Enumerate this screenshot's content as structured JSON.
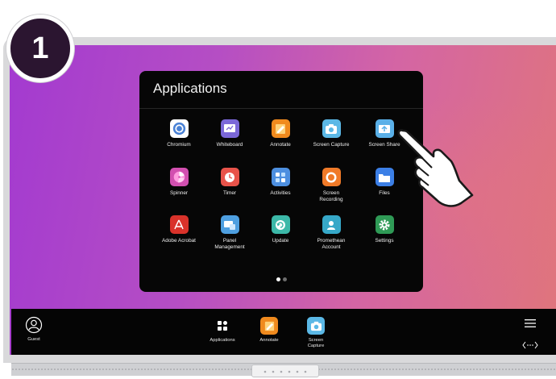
{
  "step": {
    "number": "1"
  },
  "apps_panel": {
    "title": "Applications",
    "apps": [
      {
        "label_lines": [
          "Chromium"
        ],
        "icon": "chromium-icon",
        "color": "#5b8fd6"
      },
      {
        "label_lines": [
          "Whiteboard"
        ],
        "icon": "whiteboard-icon",
        "color": "#7b68d8"
      },
      {
        "label_lines": [
          "Annotate"
        ],
        "icon": "annotate-icon",
        "color": "#f08a1e"
      },
      {
        "label_lines": [
          "Screen Capture"
        ],
        "icon": "screen-capture-icon",
        "color": "#5bb8e6"
      },
      {
        "label_lines": [
          "Screen Share"
        ],
        "icon": "screen-share-icon",
        "color": "#5ab0e8"
      },
      {
        "label_lines": [
          "Spinner"
        ],
        "icon": "spinner-icon",
        "color": "#d24fb0"
      },
      {
        "label_lines": [
          "Timer"
        ],
        "icon": "timer-icon",
        "color": "#e8534a"
      },
      {
        "label_lines": [
          "Activities"
        ],
        "icon": "activities-icon",
        "color": "#4d8fe0"
      },
      {
        "label_lines": [
          "Screen",
          "Recording"
        ],
        "icon": "screen-recording-icon",
        "color": "#f07a28"
      },
      {
        "label_lines": [
          "Files"
        ],
        "icon": "files-icon",
        "color": "#3c7fe6"
      },
      {
        "label_lines": [
          "Adobe Acrobat"
        ],
        "icon": "adobe-acrobat-icon",
        "color": "#d9322a"
      },
      {
        "label_lines": [
          "Panel",
          "Management"
        ],
        "icon": "panel-management-icon",
        "color": "#4e9fe0"
      },
      {
        "label_lines": [
          "Update"
        ],
        "icon": "update-icon",
        "color": "#3cb8a8"
      },
      {
        "label_lines": [
          "Promethean",
          "Account"
        ],
        "icon": "promethean-account-icon",
        "color": "#36a8c8"
      },
      {
        "label_lines": [
          "Settings"
        ],
        "icon": "settings-icon",
        "color": "#2f9a56"
      }
    ],
    "page_count": 2,
    "active_page": 1
  },
  "taskbar": {
    "user": {
      "label": "Guest",
      "icon": "user-icon"
    },
    "items": [
      {
        "label_lines": [
          "Applications"
        ],
        "icon": "applications-grid-icon"
      },
      {
        "label_lines": [
          "Annotate"
        ],
        "icon": "annotate-icon"
      },
      {
        "label_lines": [
          "Screen",
          "Capture"
        ],
        "icon": "screen-capture-icon"
      }
    ],
    "menu_icon": "hamburger-menu-icon",
    "expand_icon": "expand-arrows-icon"
  },
  "colors": {
    "panel_bg": "#060606",
    "taskbar_bg": "#050505",
    "badge_bg": "#2b1530"
  }
}
